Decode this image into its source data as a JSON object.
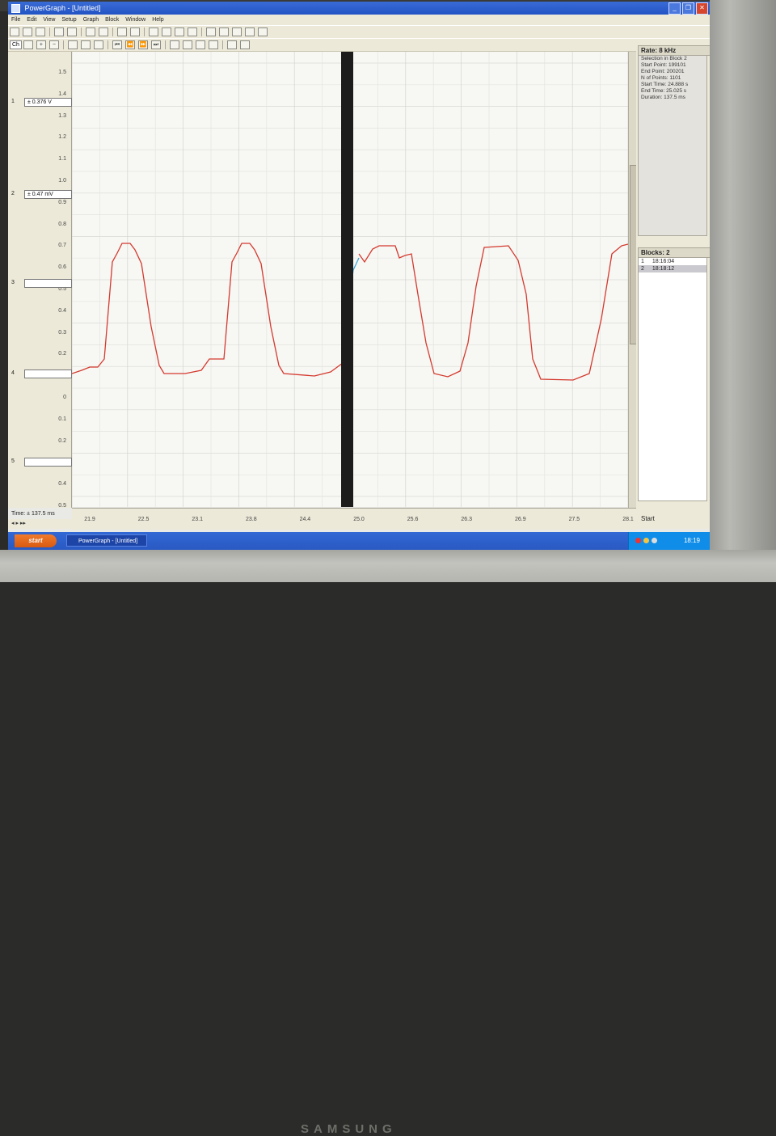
{
  "window": {
    "title": "PowerGraph - [Untitled]",
    "title_color": "#2253c4"
  },
  "menu": [
    "File",
    "Edit",
    "View",
    "Setup",
    "Graph",
    "Block",
    "Window",
    "Help"
  ],
  "toolbar": {
    "channel_select": "Ch"
  },
  "y_axis": {
    "ticks": [
      "1.5",
      "1.4",
      "1.3",
      "1.2",
      "1.1",
      "1.0",
      "0.9",
      "0.8",
      "0.7",
      "0.6",
      "0.5",
      "0.4",
      "0.3",
      "0.2",
      "0.1",
      "0",
      "0.1",
      "0.2",
      "0.3",
      "0.4",
      "0.5"
    ]
  },
  "channels": [
    {
      "num": "1",
      "value": "± 0.376 V"
    },
    {
      "num": "2",
      "value": "± 0.47 mV"
    },
    {
      "num": "3",
      "value": ""
    },
    {
      "num": "4",
      "value": ""
    },
    {
      "num": "5",
      "value": ""
    }
  ],
  "side": {
    "rate_label": "Rate: 8 kHz",
    "info": [
      "Selection in Block 2",
      "Start Point: 199101",
      "End Point: 200201",
      "N of Points: 1101",
      "Start Time: 24.888 s",
      "End Time: 25.025 s",
      "Duration: 137.5 ms"
    ],
    "blocks_label": "Blocks: 2",
    "blocks": [
      {
        "num": "1",
        "time": "18:16:04"
      },
      {
        "num": "2",
        "time": "18:18:12"
      }
    ]
  },
  "x_axis": {
    "ticks": [
      "21.9",
      "22.5",
      "23.1",
      "23.8",
      "24.4",
      "25.0",
      "25.6",
      "26.3",
      "26.9",
      "27.5",
      "28.1"
    ]
  },
  "time_label": "Time: ± 137.5 ms",
  "start_button": "Start",
  "taskbar": {
    "start_label": "start",
    "task": "PowerGraph - [Untitled]",
    "clock": "18:19"
  },
  "brand": "SAMSUNG",
  "trace_color": "#d43a2e",
  "selection_trace_color": "#39a7d8"
}
